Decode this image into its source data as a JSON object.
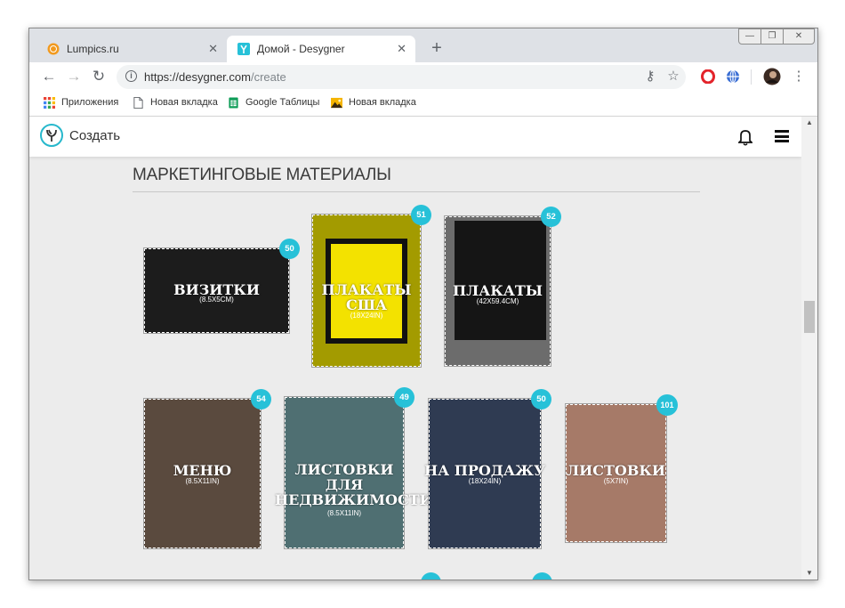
{
  "browser": {
    "tabs": [
      {
        "label": "Lumpics.ru",
        "active": false,
        "favicon": "orange-circle-icon"
      },
      {
        "label": "Домой - Desygner",
        "active": true,
        "favicon": "desygner-icon"
      }
    ],
    "url_host": "https://desygner.com",
    "url_path": "/create",
    "bookmarks": [
      {
        "label": "Приложения",
        "icon": "apps-grid-icon"
      },
      {
        "label": "Новая вкладка",
        "icon": "page-icon"
      },
      {
        "label": "Google Таблицы",
        "icon": "sheets-icon"
      },
      {
        "label": "Новая вкладка",
        "icon": "image-icon"
      }
    ]
  },
  "site": {
    "header_title": "Создать",
    "section_title": "МАРКЕТИНГОВЫЕ МАТЕРИАЛЫ"
  },
  "cards": [
    {
      "name": "ВИЗИТКИ",
      "size": "(8.5X5CM)",
      "count": "50",
      "bg": "#1c1c1c"
    },
    {
      "name": "ПЛАКАТЫ США",
      "size": "(18X24IN)",
      "count": "51",
      "bg": "#a39b00"
    },
    {
      "name": "ПЛАКАТЫ",
      "size": "(42X59.4CM)",
      "count": "52",
      "bg": "#2a2a2a"
    },
    {
      "name": "МЕНЮ",
      "size": "(8.5X11IN)",
      "count": "54",
      "bg": "#5a4a3e"
    },
    {
      "name": "ЛИСТОВКИ ДЛЯ НЕДВИЖИМОСТИ",
      "size": "(8.5X11IN)",
      "count": "49",
      "bg": "#4f6f72"
    },
    {
      "name": "НА ПРОДАЖУ",
      "size": "(18X24IN)",
      "count": "50",
      "bg": "#2f3b52"
    },
    {
      "name": "ЛИСТОВКИ",
      "size": "(5X7IN)",
      "count": "101",
      "bg": "#a67a68"
    }
  ],
  "colors": {
    "accent": "#27c1d8"
  }
}
